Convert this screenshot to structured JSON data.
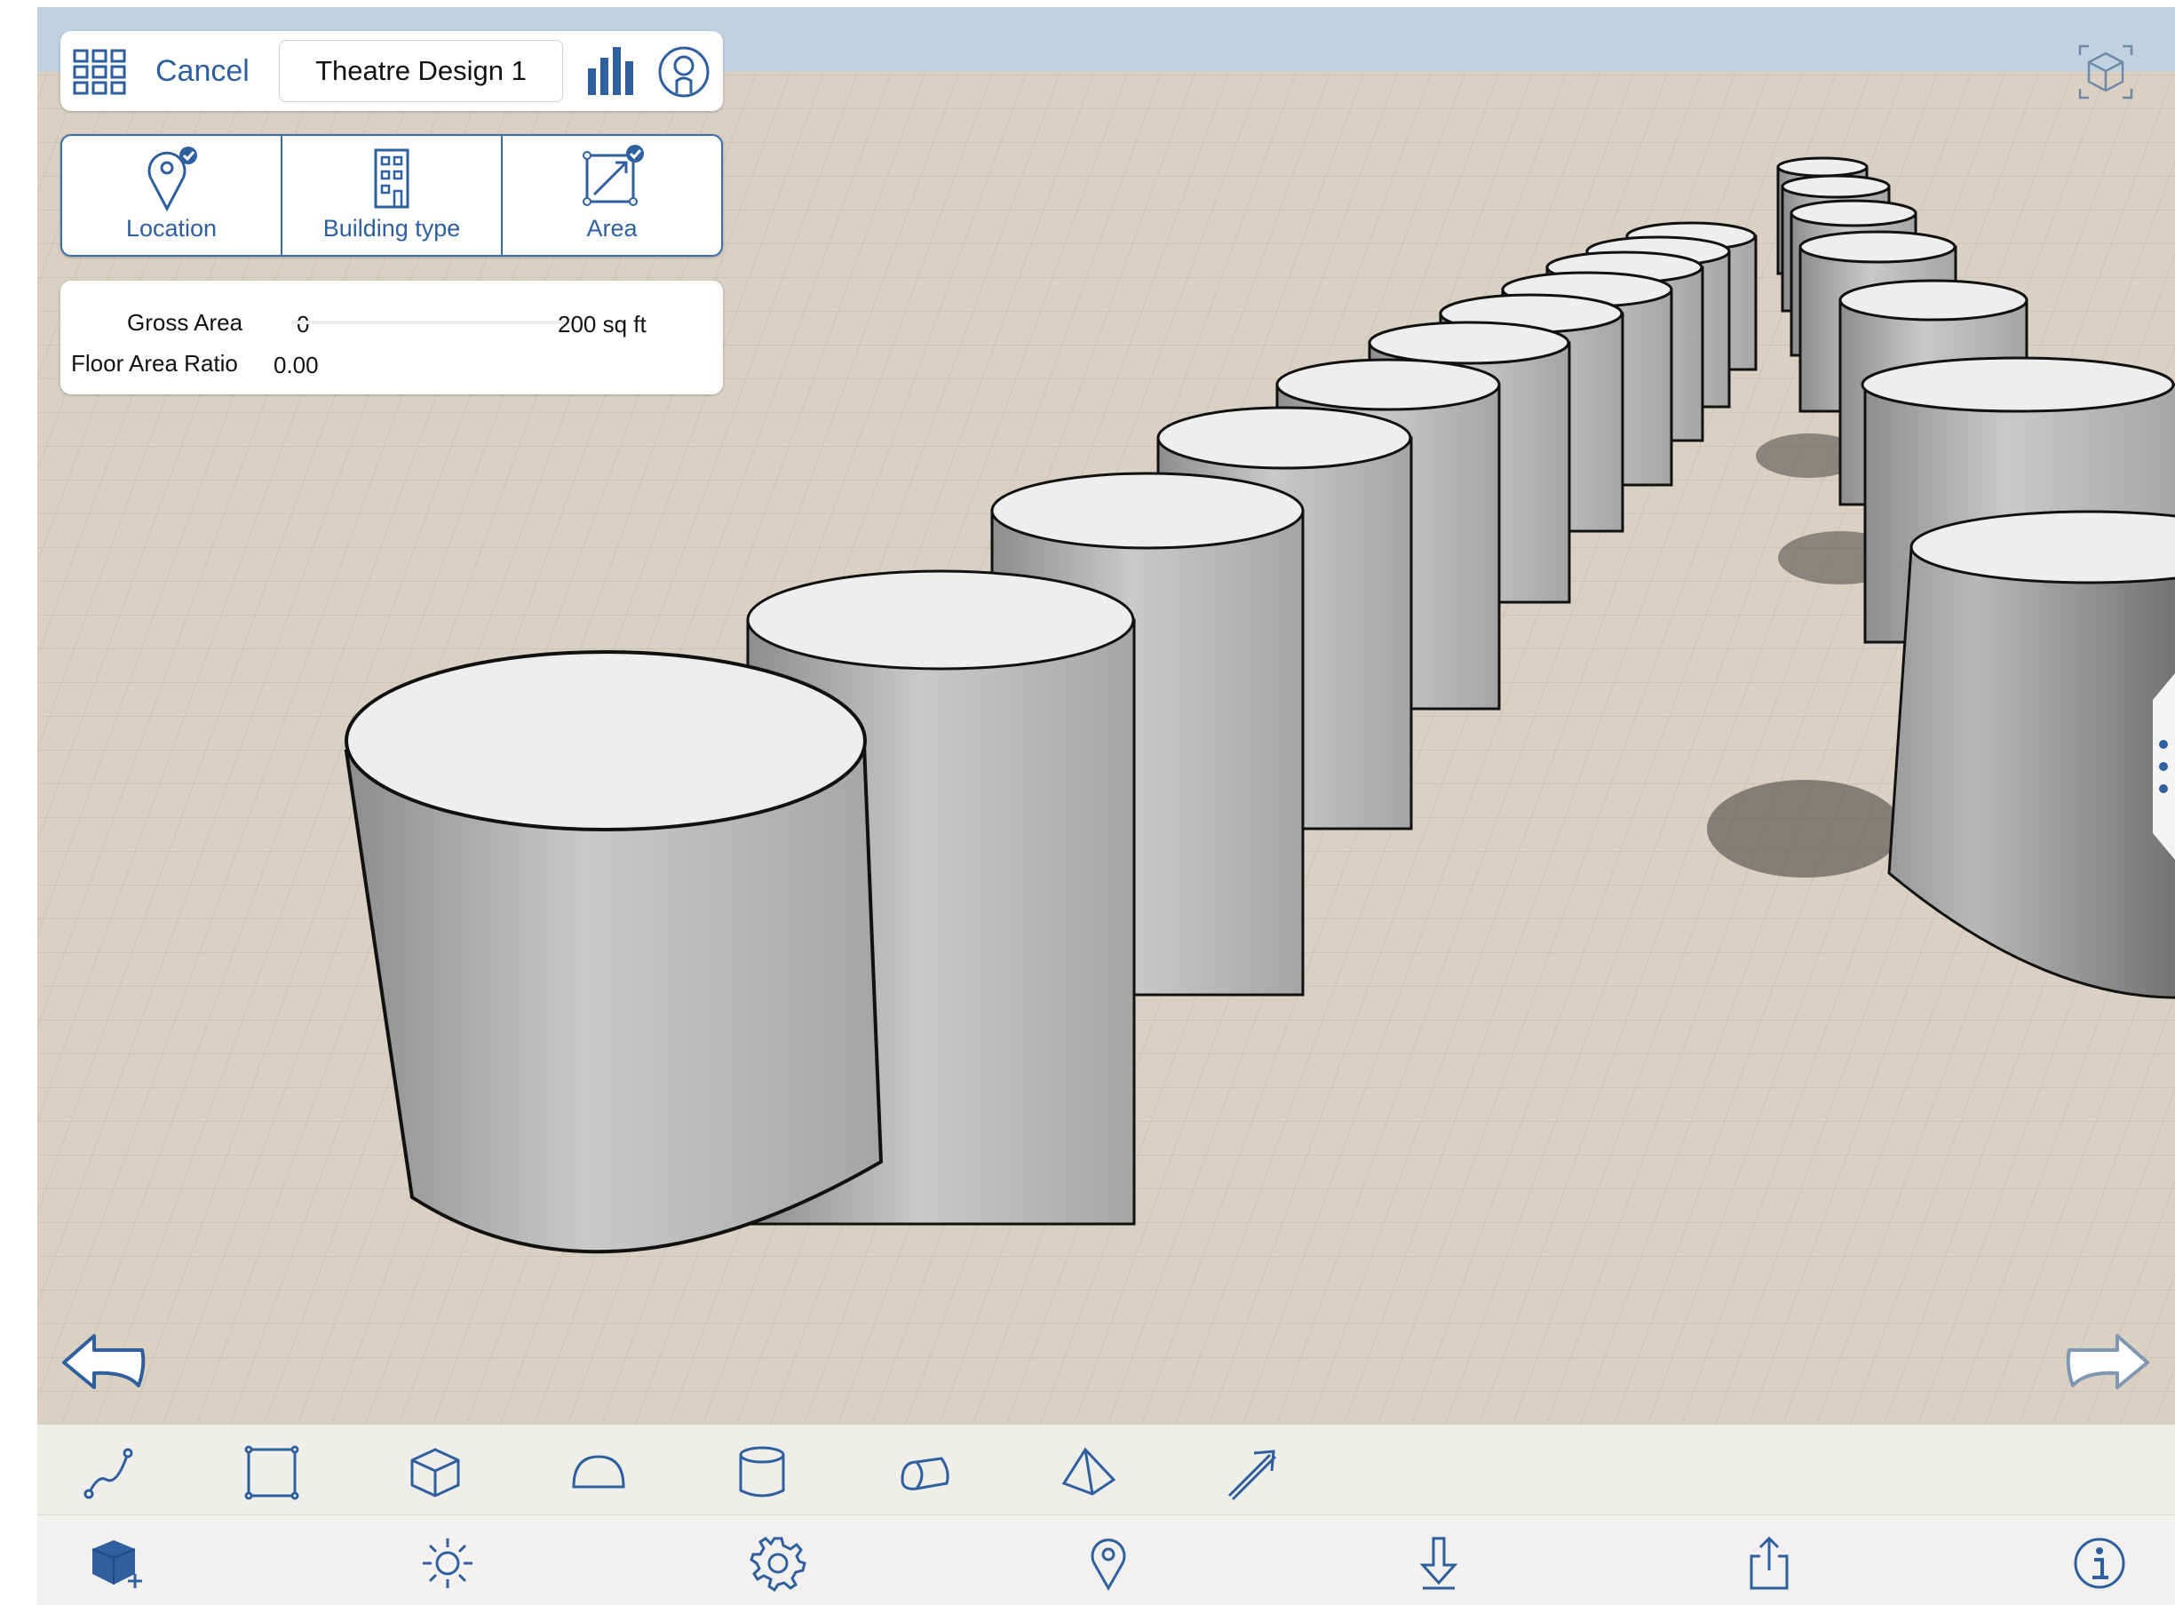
{
  "app": {
    "accent_color": "#2e5f9e",
    "sky_color": "#c0d2e0",
    "ground_color": "#d8cdbd"
  },
  "header": {
    "apps_icon": "grid-icon",
    "cancel_label": "Cancel",
    "design_title": "Theatre Design 1",
    "chart_icon": "bar-chart-icon",
    "profile_icon": "user-profile-icon"
  },
  "setup_tabs": [
    {
      "label": "Location",
      "icon": "location-pin-icon",
      "checked": true
    },
    {
      "label": "Building type",
      "icon": "building-icon",
      "checked": false
    },
    {
      "label": "Area",
      "icon": "area-icon",
      "checked": true
    }
  ],
  "stats": {
    "gross_area_label": "Gross Area",
    "gross_area_value": "0",
    "gross_area_max": "200 sq ft",
    "far_label": "Floor Area Ratio",
    "far_value": "0.00"
  },
  "viewport": {
    "undo_icon": "undo-arrow-icon",
    "redo_icon": "redo-arrow-icon",
    "view_cube_icon": "view-cube-icon",
    "side_panel_icon": "more-vertical-icon"
  },
  "drawing_tools": [
    "freehand-line-icon",
    "rectangle-icon",
    "box-icon",
    "dome-icon",
    "cylinder-icon",
    "half-cylinder-icon",
    "pyramid-icon",
    "arrow-tool-icon"
  ],
  "main_tools": [
    "add-object-icon",
    "sun-lighting-icon",
    "settings-gear-icon",
    "location-marker-icon",
    "download-icon",
    "share-icon",
    "info-icon"
  ]
}
